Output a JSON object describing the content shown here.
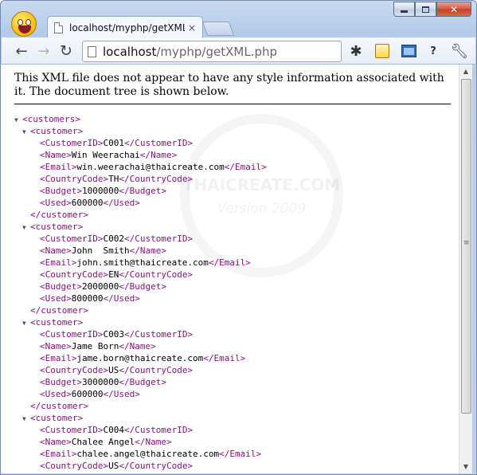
{
  "browser": {
    "tab_title": "localhost/myphp/getXML",
    "tab_close": "×",
    "url_host": "localhost",
    "url_path": "/myphp/getXML.php"
  },
  "toolbar_icons": [
    "back-arrow-icon",
    "forward-arrow-icon",
    "reload-icon",
    "bug-icon",
    "calendar-icon",
    "window-icon",
    "help-icon",
    "wrench-icon"
  ],
  "notice": "This XML file does not appear to have any style information associated with it. The document tree is shown below.",
  "watermark": {
    "line1": "THAICREATE.COM",
    "line2": "Version 2009"
  },
  "xml": {
    "root": "customers",
    "item_tag": "customer",
    "field_tags": [
      "CustomerID",
      "Name",
      "Email",
      "CountryCode",
      "Budget",
      "Used"
    ],
    "customers": [
      {
        "CustomerID": "C001",
        "Name": "Win Weerachai",
        "Email": "win.weerachai@thaicreate.com",
        "CountryCode": "TH",
        "Budget": "1000000",
        "Used": "600000"
      },
      {
        "CustomerID": "C002",
        "Name": "John  Smith",
        "Email": "john.smith@thaicreate.com",
        "CountryCode": "EN",
        "Budget": "2000000",
        "Used": "800000"
      },
      {
        "CustomerID": "C003",
        "Name": "Jame Born",
        "Email": "jame.born@thaicreate.com",
        "CountryCode": "US",
        "Budget": "3000000",
        "Used": "600000"
      },
      {
        "CustomerID": "C004",
        "Name": "Chalee Angel",
        "Email": "chalee.angel@thaicreate.com",
        "CountryCode": "US"
      }
    ]
  },
  "colors": {
    "tag": "#881280",
    "text": "#000000",
    "chrome": "#b8cdea"
  }
}
